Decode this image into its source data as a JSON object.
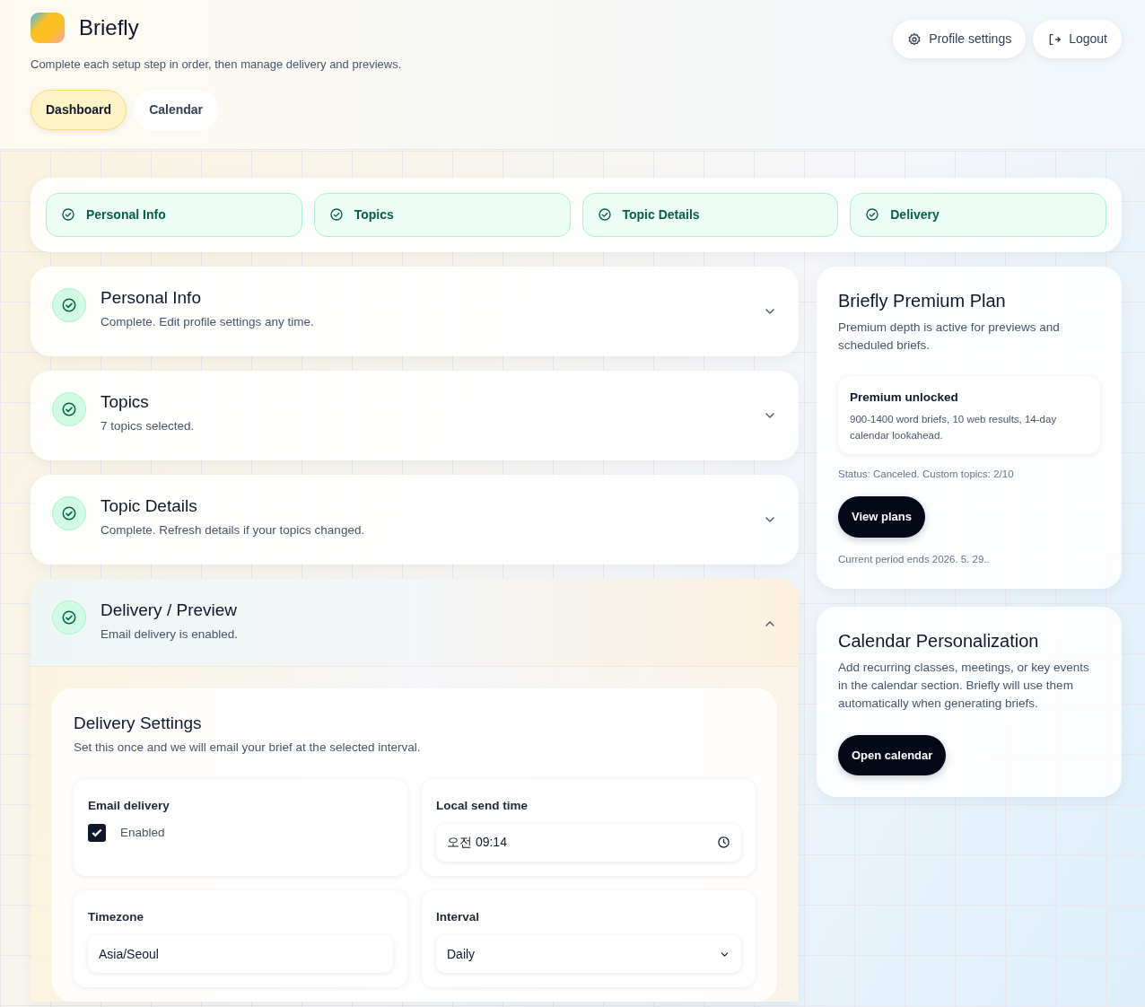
{
  "app": {
    "name": "Briefly",
    "subtitle": "Complete each setup step in order, then manage delivery and previews."
  },
  "nav_tabs": [
    {
      "label": "Dashboard",
      "selected": true
    },
    {
      "label": "Calendar",
      "selected": false
    }
  ],
  "header_buttons": [
    {
      "label": "Profile settings",
      "kind": "settings"
    },
    {
      "label": "Logout",
      "kind": "logout"
    }
  ],
  "steps": [
    {
      "label": "Personal Info",
      "done": true
    },
    {
      "label": "Topics",
      "done": true
    },
    {
      "label": "Topic Details",
      "done": true
    },
    {
      "label": "Delivery",
      "done": true
    }
  ],
  "sections": [
    {
      "title": "Personal Info",
      "summary": "Complete. Edit profile settings any time.",
      "done": true,
      "expanded": false
    },
    {
      "title": "Topics",
      "summary": "7 topics selected.",
      "done": true,
      "expanded": false
    },
    {
      "title": "Topic Details",
      "summary": "Complete. Refresh details if your topics changed.",
      "done": true,
      "expanded": false
    },
    {
      "title": "Delivery / Preview",
      "summary": "Email delivery is enabled.",
      "done": true,
      "expanded": true
    }
  ],
  "delivery_settings": {
    "title": "Delivery Settings",
    "description": "Set this once and we will email your brief at the selected interval.",
    "fields": [
      {
        "kind": "checkbox",
        "label": "Email delivery",
        "option": "Enabled",
        "checked": true
      },
      {
        "kind": "time",
        "label": "Local send time",
        "value": "오전 09:14"
      },
      {
        "kind": "text",
        "label": "Timezone",
        "value": "Asia/Seoul"
      },
      {
        "kind": "select",
        "label": "Interval",
        "value": "Daily"
      }
    ]
  },
  "plan_card": {
    "title": "Briefly Premium Plan",
    "description": "Premium depth is active for previews and scheduled briefs.",
    "feature_title": "Premium unlocked",
    "feature_text": "900-1400 word briefs, 10 web results, 14-day calendar lookahead.",
    "status": "Status: Canceled. Custom topics: 2/10",
    "button": "View plans",
    "period": "Current period ends 2026. 5. 29.."
  },
  "calendar_card": {
    "title": "Calendar Personalization",
    "description": "Add recurring classes, meetings, or key events in the calendar section. Briefly will use them automatically when generating briefs.",
    "button": "Open calendar"
  }
}
